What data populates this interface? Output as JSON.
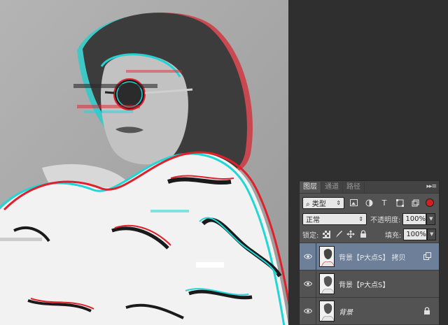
{
  "panel": {
    "tabs": [
      {
        "label": "图层",
        "active": true
      },
      {
        "label": "通道",
        "active": false
      },
      {
        "label": "路径",
        "active": false
      }
    ],
    "menu_glyph": "▸▸≡"
  },
  "filter": {
    "dropdown": "⌕ 类型",
    "icons": [
      "image-filter-icon",
      "adjustment-filter-icon",
      "type-filter-icon",
      "shape-filter-icon",
      "smart-object-filter-icon"
    ],
    "type_glyph": "T"
  },
  "blend": {
    "mode": "正常",
    "opacity_label": "不透明度:",
    "opacity_value": "100%"
  },
  "lock": {
    "label": "锁定:",
    "icons": [
      "lock-transparent-pixels-icon",
      "lock-image-pixels-icon",
      "lock-position-icon",
      "lock-all-icon"
    ],
    "fill_label": "填充:",
    "fill_value": "100%"
  },
  "layers": [
    {
      "name": "背景【P大点S】 拷贝",
      "visible": true,
      "selected": true,
      "italic": false,
      "badge": "smart-object-icon"
    },
    {
      "name": "背景【P大点S】",
      "visible": true,
      "selected": false,
      "italic": false,
      "badge": ""
    },
    {
      "name": "背景",
      "visible": true,
      "selected": false,
      "italic": true,
      "badge": "lock-icon"
    }
  ],
  "colors": {
    "canvas_bg": "#aaaaaa",
    "panel_bg": "#535353",
    "selected_layer": "#6e7f99",
    "glitch_red": "#e0202a",
    "glitch_cyan": "#20d6d6"
  }
}
